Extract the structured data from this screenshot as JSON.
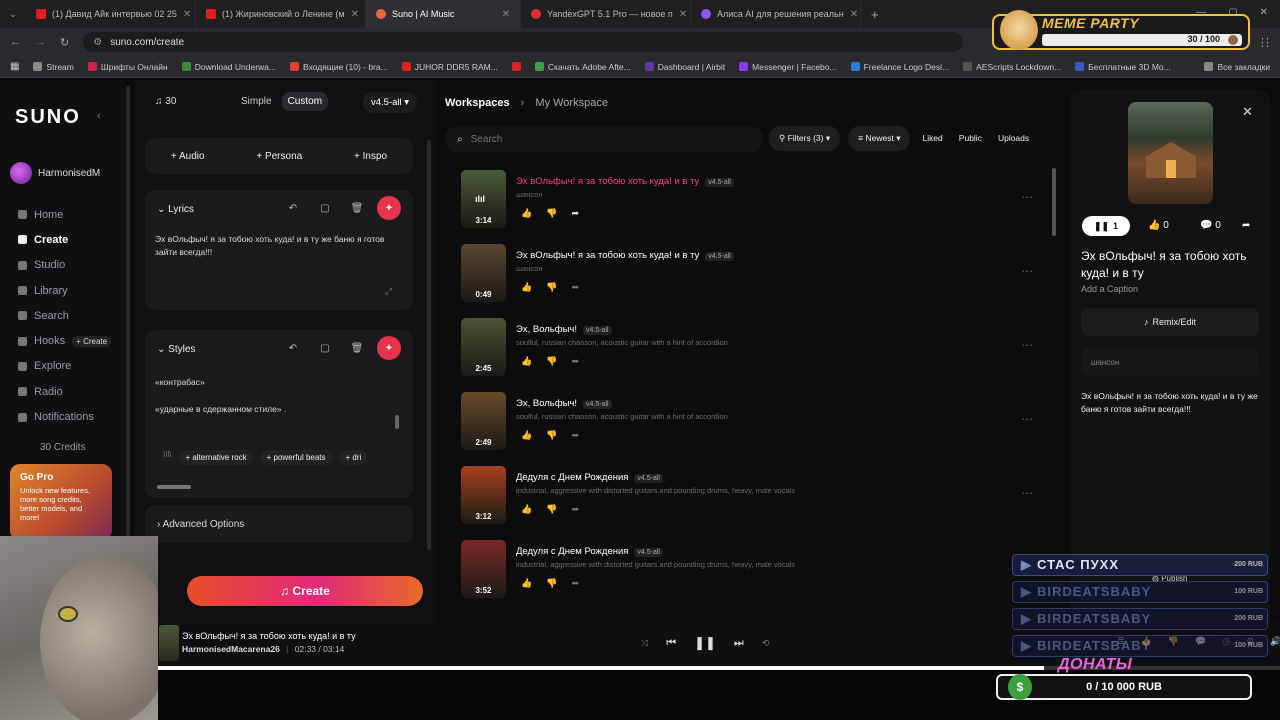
{
  "browser": {
    "tabs": [
      {
        "title": "(1) Давид Айк интервью 02 25"
      },
      {
        "title": "(1) Жириновский о Ленине (м"
      },
      {
        "title": "Suno | AI Music"
      },
      {
        "title": "YandexGPT 5.1 Pro — новое п"
      },
      {
        "title": "Алиса AI для решения реальн"
      }
    ],
    "url": "suno.com/create",
    "bookmarks": [
      "Stream",
      "Шрифты Онлайн",
      "Download Underwa...",
      "Входящие (10) - bra...",
      "JUHOR DDR5 RAM...",
      "Скачать Adobe Afte...",
      "Dashboard | Airbit",
      "Messenger | Facebo...",
      "Freelance Logo Desi...",
      "AEScripts Lockdown...",
      "Бесплатные 3D Mo..."
    ],
    "all_bookmarks": "Все закладки"
  },
  "sidebar": {
    "logo": "SUNO",
    "username": "HarmonisedM",
    "items": [
      {
        "label": "Home"
      },
      {
        "label": "Create"
      },
      {
        "label": "Studio"
      },
      {
        "label": "Library"
      },
      {
        "label": "Search"
      },
      {
        "label": "Hooks"
      },
      {
        "label": "Explore"
      },
      {
        "label": "Radio"
      },
      {
        "label": "Notifications"
      }
    ],
    "hooks_create": "+ Create",
    "credits": "30 Credits",
    "gopro": {
      "title": "Go Pro",
      "text": "Unlock new features, more song credits, better models, and more!"
    }
  },
  "create_panel": {
    "credits": "30",
    "mode_simple": "Simple",
    "mode_custom": "Custom",
    "model": "v4.5-all",
    "add_audio": "+ Audio",
    "add_persona": "+ Persona",
    "add_inspo": "+ Inspo",
    "lyrics_label": "Lyrics",
    "lyrics_text": "Эх вОльфыч! я за тобою хоть куда! и в ту же баню я готов зайти всегда!!!",
    "styles_label": "Styles",
    "styles_line1": "«контрабас»",
    "styles_line2": "«ударные в сдержанном стиле» .",
    "style_tags": [
      "+ alternative rock",
      "+ powerful beats",
      "+ dri"
    ],
    "advanced": "Advanced Options",
    "create_button": "Create"
  },
  "workspace": {
    "breadcrumb_root": "Workspaces",
    "breadcrumb_current": "My Workspace",
    "search_placeholder": "Search",
    "filters": "Filters (3)",
    "sort": "Newest",
    "liked": "Liked",
    "public": "Public",
    "uploads": "Uploads",
    "songs": [
      {
        "title": "Эх вОльфыч! я за тобою хоть куда! и в ту",
        "version": "v4.5-all",
        "style": "шансон",
        "duration": "3:14",
        "active": true,
        "thumb": "#4a5a3a"
      },
      {
        "title": "Эх вОльфыч! я за тобою хоть куда! и в ту",
        "version": "v4.5-all",
        "style": "шансон",
        "duration": "0:49",
        "active": false,
        "thumb": "#5a4632"
      },
      {
        "title": "Эх, Вольфыч!",
        "version": "v4.5-all",
        "style": "soulful, russian chanson, acoustic guitar with a hint of accordion",
        "duration": "2:45",
        "active": false,
        "thumb": "#4b5234"
      },
      {
        "title": "Эх, Вольфыч!",
        "version": "v4.5-all",
        "style": "soulful, russian chanson, acoustic guitar with a hint of accordion",
        "duration": "2:49",
        "active": false,
        "thumb": "#6a4a2a"
      },
      {
        "title": "Дедуля с Днем Рождения",
        "version": "v4.5-all",
        "style": "industrial, aggressive with distorted guitars and pounding drums, heavy, male vocals",
        "duration": "3:12",
        "active": false,
        "thumb": "#a8421e"
      },
      {
        "title": "Дедуля с Днем Рождения",
        "version": "v4.5-all",
        "style": "industrial, aggressive with distorted guitars and pounding drums, heavy, male vocals",
        "duration": "3:52",
        "active": false,
        "thumb": "#7a2a2a"
      }
    ]
  },
  "detail": {
    "plays": "1",
    "likes": "0",
    "comments": "0",
    "title": "Эх вОльфыч! я за тобою хоть куда! и в ту",
    "caption": "Add a Caption",
    "remix": "Remix/Edit",
    "style": "шансон",
    "lyrics": "Эх вОльфыч! я за тобою хоть куда! и в ту же баню я готов зайти всегда!!!",
    "publish": "Publish"
  },
  "player": {
    "title": "Эх вОльфыч! я за тобою хоть куда! и в ту",
    "artist": "HarmonisedMacarena26",
    "current": "02:33 /",
    "total": "03:14",
    "progress": 0.79
  },
  "stream_overlay": {
    "meme_title": "MEME PARTY",
    "meme_count": "30 / 100",
    "donors": [
      {
        "name": "СТАС ПУХХ",
        "amount": "200 RUB"
      },
      {
        "name": "BIRDEATSBABY",
        "amount": "100 RUB"
      },
      {
        "name": "BIRDEATSBABY",
        "amount": "200 RUB"
      },
      {
        "name": "BIRDEATSBABY",
        "amount": "100 RUB"
      }
    ],
    "donate_title": "ДОНАТЫ",
    "donate_progress": "0 / 10 000 RUB"
  },
  "colors": {
    "accent": "#e8344a",
    "pink_title": "#ff3d7f",
    "gold": "#f0c040"
  }
}
